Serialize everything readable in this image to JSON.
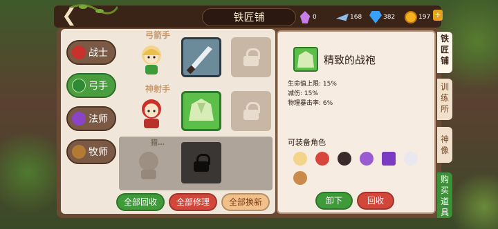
{
  "header": {
    "title": "铁匠铺",
    "back_icon": "back-arrow-icon",
    "resources": [
      {
        "name": "purple-crystal-icon",
        "value": "0"
      },
      {
        "name": "silver-fish-icon",
        "value": "168"
      },
      {
        "name": "diamond-icon",
        "value": "382"
      },
      {
        "name": "gold-coin-icon",
        "value": "197"
      }
    ]
  },
  "class_tabs": [
    {
      "label": "战士",
      "icon": "warrior-helmet-icon",
      "active": false
    },
    {
      "label": "弓手",
      "icon": "archer-feather-icon",
      "active": true
    },
    {
      "label": "法师",
      "icon": "mage-flame-icon",
      "active": false
    },
    {
      "label": "牧师",
      "icon": "priest-book-icon",
      "active": false
    }
  ],
  "heroes": [
    {
      "name": "弓箭手",
      "portrait": "archer-girl-portrait",
      "equipment": "dagger-icon",
      "second_slot": "locked"
    },
    {
      "name": "神射手",
      "portrait": "sharpshooter-portrait",
      "equipment": "green-robe-icon",
      "second_slot": "locked"
    },
    {
      "name": "猎…",
      "portrait": "hunter-portrait-locked",
      "equipment": "locked",
      "second_slot": "locked"
    }
  ],
  "actions": {
    "recycle_all": "全部回收",
    "repair_all": "全部修理",
    "replace_all": "全部换新"
  },
  "item": {
    "icon": "green-robe-icon",
    "name": "精致的战袍",
    "stats": [
      "生命值上限: 15%",
      "减伤: 15%",
      "物理暴击率: 6%"
    ],
    "equip_label": "可装备角色",
    "equip_heroes": [
      "blonde-hero-icon",
      "red-hero-icon",
      "dark-horned-hero-icon",
      "purple-haired-hero-icon",
      "witch-hat-icon",
      "white-hair-hero-icon",
      "green-archer-hero-icon"
    ],
    "unequip_label": "卸下",
    "recycle_label": "回收"
  },
  "side_tabs": [
    {
      "label": "铁匠铺",
      "active": true
    },
    {
      "label": "训练所",
      "active": false
    },
    {
      "label": "神像",
      "active": false
    },
    {
      "label": "购买道具",
      "active": false
    }
  ],
  "colors": {
    "accent_green": "#3f9b3a",
    "accent_red": "#d2473a",
    "panel_brown": "#6b4a33",
    "parchment": "#f0e6da"
  }
}
